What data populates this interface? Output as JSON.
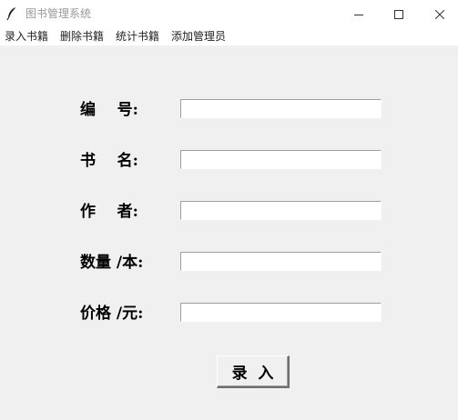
{
  "window": {
    "title": "图书管理系统",
    "icon": "feather-icon",
    "controls": [
      "minimize-icon",
      "maximize-icon",
      "close-icon"
    ]
  },
  "menu": {
    "items": [
      {
        "label": "录入书籍"
      },
      {
        "label": "删除书籍"
      },
      {
        "label": "统计书籍"
      },
      {
        "label": "添加管理员"
      }
    ]
  },
  "form": {
    "fields": [
      {
        "label": "编    号:",
        "value": ""
      },
      {
        "label": "书    名:",
        "value": ""
      },
      {
        "label": "作    者:",
        "value": ""
      },
      {
        "label": "数量 /本:",
        "value": ""
      },
      {
        "label": "价格 /元:",
        "value": ""
      }
    ],
    "submit_label": "录  入"
  },
  "colors": {
    "window_bg": "#f0f0f0",
    "titlebar_bg": "#ffffff",
    "title_text": "#999999",
    "input_bg": "#ffffff"
  }
}
